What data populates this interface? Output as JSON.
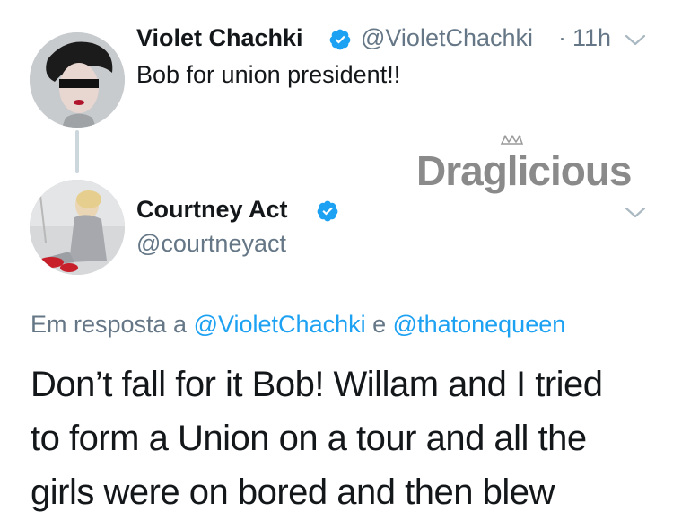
{
  "tweet1": {
    "name": "Violet Chachki",
    "handle": "@VioletChachki",
    "separator": "·",
    "time": "11h",
    "text": "Bob for union president!!"
  },
  "tweet2": {
    "name": "Courtney Act",
    "handle": "@courtneyact",
    "reply_prefix": "Em resposta a",
    "reply_mention1": "@VioletChachki",
    "reply_join": "e",
    "reply_mention2": "@thatonequeen",
    "text_lines": [
      "Don’t fall for it Bob! Willam and I tried",
      "to form a Union on a tour and all the",
      "girls were on bored and then blew"
    ]
  },
  "watermark": {
    "brand": "Draglicious"
  },
  "icons": {
    "verified": "verified-badge-icon",
    "caret": "chevron-down-icon",
    "crown": "crown-icon"
  },
  "colors": {
    "verified_blue": "#1da1f2",
    "link_blue": "#1da1f2",
    "secondary_text": "#657786",
    "primary_text": "#14171a",
    "thread_line": "#ccd6dd",
    "watermark_gray": "#8a8a8a"
  }
}
